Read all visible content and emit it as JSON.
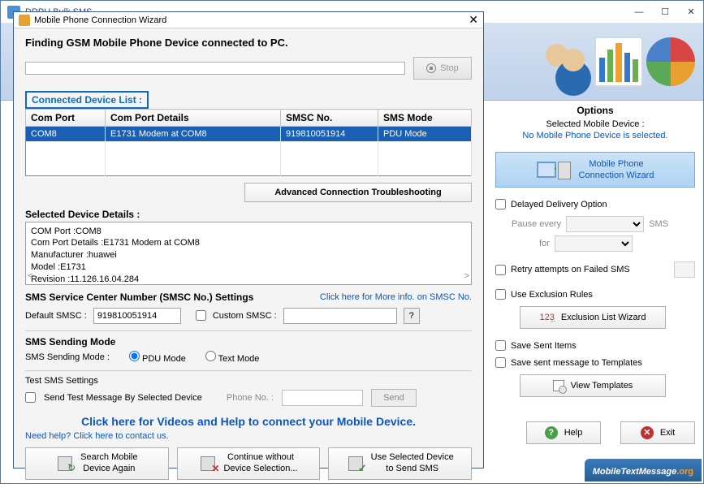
{
  "main": {
    "title": "DRPU Bulk SMS"
  },
  "options": {
    "title": "Options",
    "selected_label": "Selected Mobile Device :",
    "selected_value": "No Mobile Phone Device is selected.",
    "wizard_btn_line1": "Mobile Phone",
    "wizard_btn_line2": "Connection  Wizard",
    "delayed": "Delayed Delivery Option",
    "pause_every": "Pause every",
    "sms_suffix": "SMS",
    "for": "for",
    "retry": "Retry attempts on Failed SMS",
    "use_excl": "Use Exclusion Rules",
    "excl_btn": "Exclusion List Wizard",
    "save_sent": "Save Sent Items",
    "save_tmpl": "Save sent message to Templates",
    "tmpl_btn": "View Templates",
    "help": "Help",
    "exit": "Exit",
    "excl_icon_text": "123"
  },
  "footer": {
    "brand": "MobileTextMessage",
    "tld": ".org"
  },
  "dialog": {
    "title": "Mobile Phone Connection Wizard",
    "finding": "Finding GSM Mobile Phone Device connected to PC.",
    "stop": "Stop",
    "cdl": "Connected Device List :",
    "table": {
      "headers": [
        "Com Port",
        "Com Port Details",
        "SMSC No.",
        "SMS Mode"
      ],
      "rows": [
        {
          "port": "COM8",
          "details": "E1731 Modem at COM8",
          "smsc": "919810051914",
          "mode": "PDU Mode"
        }
      ]
    },
    "adv_btn": "Advanced Connection Troubleshooting",
    "sdd_title": "Selected Device Details :",
    "sdd_lines": [
      "COM Port :COM8",
      "Com Port Details :E1731 Modem at COM8",
      "Manufacturer :huawei",
      "Model :E1731",
      "Revision :11.126.16.04.284"
    ],
    "smsc_title": "SMS Service Center Number (SMSC No.) Settings",
    "smsc_info": "Click here for More info. on SMSC No.",
    "default_smsc_label": "Default SMSC :",
    "default_smsc_value": "919810051914",
    "custom_smsc": "Custom SMSC :",
    "mode_title": "SMS Sending Mode",
    "mode_label": "SMS Sending Mode :",
    "mode_pdu": "PDU Mode",
    "mode_text": "Text Mode",
    "test_title": "Test SMS Settings",
    "test_check": "Send Test Message By Selected Device",
    "phone_label": "Phone No. :",
    "send": "Send",
    "vids": "Click here for Videos and Help to connect your Mobile Device.",
    "need_help": "Need help? Click here to contact us.",
    "btns": {
      "search_l1": "Search Mobile",
      "search_l2": "Device Again",
      "cont_l1": "Continue without",
      "cont_l2": "Device Selection...",
      "use_l1": "Use Selected Device",
      "use_l2": "to Send SMS"
    }
  }
}
